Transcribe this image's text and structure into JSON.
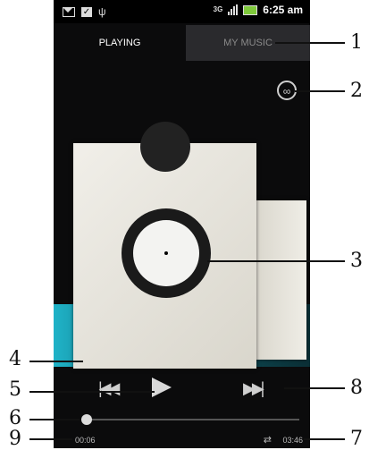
{
  "status_bar": {
    "network": "3G",
    "time": "6:25 am"
  },
  "tabs": [
    "PLAYING",
    "MY MUSIC"
  ],
  "icons": {
    "infinite": "infinite-icon",
    "prev": "previous-icon",
    "play": "play-icon",
    "next": "next-icon",
    "repeat": "repeat-icon"
  },
  "player": {
    "elapsed": "00:06",
    "duration": "03:46",
    "progress": 0.026
  },
  "callouts": [
    "1",
    "2",
    "3",
    "4",
    "5",
    "6",
    "7",
    "8",
    "9"
  ],
  "colors": {
    "accent_teal": "#1fb3c8",
    "background": "#0b0b0c"
  }
}
